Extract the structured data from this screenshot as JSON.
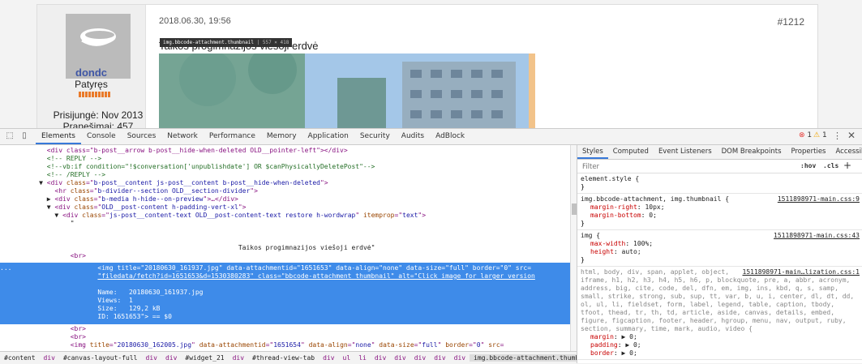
{
  "page": {
    "user": {
      "name": "dondc",
      "rank": "Patyręs",
      "joined": "Prisijungė: Nov 2013",
      "posts": "Pranešimai: 457"
    },
    "post": {
      "date": "2018.06.30, 19:56",
      "number": "#1212",
      "title": "Taikos progimnazijos viešoji erdvė",
      "tooltip_selector": "img.bbcode-attachment.thumbnail",
      "tooltip_size": "557 × 418"
    }
  },
  "devtools": {
    "tabs": [
      "Elements",
      "Console",
      "Sources",
      "Network",
      "Performance",
      "Memory",
      "Application",
      "Security",
      "Audits",
      "AdBlock"
    ],
    "active_tab": "Elements",
    "errors": "1",
    "warnings": "1",
    "dom": [
      {
        "indent": "            ",
        "parts": [
          [
            "t",
            "<div class=\"b-post__arrow b-post__hide-when-deleted OLD__pointer-left\"></div>"
          ]
        ]
      },
      {
        "indent": "            ",
        "parts": [
          [
            "c",
            "<!-- REPLY -->"
          ]
        ]
      },
      {
        "indent": "            ",
        "parts": [
          [
            "c",
            "<!--vb:if condition=\"!$conversation['unpublishdate'] OR $canPhysicallyDeletePost\"-->"
          ]
        ]
      },
      {
        "indent": "            ",
        "parts": [
          [
            "c",
            "<!-- /REPLY -->"
          ]
        ]
      },
      {
        "indent": "          ▼ ",
        "parts": [
          [
            "t",
            "<div "
          ],
          [
            "a",
            "class"
          ],
          [
            "t",
            "=\""
          ],
          [
            "v",
            "b-post__content js-post__content b-post__hide-when-deleted"
          ],
          [
            "t",
            "\">"
          ]
        ]
      },
      {
        "indent": "              ",
        "parts": [
          [
            "t",
            "<hr "
          ],
          [
            "a",
            "class"
          ],
          [
            "t",
            "=\""
          ],
          [
            "v",
            "b-divider--section OLD__section-divider"
          ],
          [
            "t",
            "\">"
          ]
        ]
      },
      {
        "indent": "            ▶ ",
        "parts": [
          [
            "t",
            "<div "
          ],
          [
            "a",
            "class"
          ],
          [
            "t",
            "=\""
          ],
          [
            "v",
            "b-media h-hide--on-preview"
          ],
          [
            "t",
            "\">…</div>"
          ]
        ]
      },
      {
        "indent": "            ▼ ",
        "parts": [
          [
            "t",
            "<div "
          ],
          [
            "a",
            "class"
          ],
          [
            "t",
            "=\""
          ],
          [
            "v",
            "OLD__post-content h-padding-vert-xl"
          ],
          [
            "t",
            "\">"
          ]
        ]
      },
      {
        "indent": "              ▼ ",
        "parts": [
          [
            "t",
            "<div "
          ],
          [
            "a",
            "class"
          ],
          [
            "t",
            "=\""
          ],
          [
            "v",
            "js-post__content-text OLD__post-content-text restore h-wordwrap"
          ],
          [
            "t",
            "\" "
          ],
          [
            "a",
            "itemprop"
          ],
          [
            "t",
            "=\""
          ],
          [
            "v",
            "text"
          ],
          [
            "t",
            "\">"
          ]
        ]
      },
      {
        "indent": "                  ",
        "parts": [
          [
            "x",
            "\""
          ]
        ]
      },
      {
        "indent": "",
        "parts": [
          [
            "x",
            " "
          ]
        ]
      },
      {
        "indent": "",
        "parts": [
          [
            "x",
            " "
          ]
        ]
      },
      {
        "indent": "                                                             ",
        "parts": [
          [
            "x",
            "Taikos progimnazijos viešoji erdvė\""
          ]
        ]
      },
      {
        "indent": "                  ",
        "parts": [
          [
            "t",
            "<br>"
          ]
        ]
      }
    ],
    "selected": [
      "<img title=\"20180630_161937.jpg\" data-attachmentid=\"1651653\" data-align=\"none\" data-size=\"full\" border=\"0\" src=",
      "\"filedata/fetch?id=1651653&d=1530380283\" class=\"bbcode-attachment thumbnail\" alt=\"Click image for larger version",
      "",
      "Name:   20180630_161937.jpg",
      "Views:  1",
      "Size:   129,2 kB",
      "ID: 1651653\"> == $0"
    ],
    "dom_after": [
      {
        "indent": "                  ",
        "parts": [
          [
            "t",
            "<br>"
          ]
        ]
      },
      {
        "indent": "                  ",
        "parts": [
          [
            "t",
            "<br>"
          ]
        ]
      },
      {
        "indent": "                  ",
        "parts": [
          [
            "t",
            "<img "
          ],
          [
            "a",
            "title"
          ],
          [
            "t",
            "=\""
          ],
          [
            "v",
            "20180630_162005.jpg"
          ],
          [
            "t",
            "\" "
          ],
          [
            "a",
            "data-attachmentid"
          ],
          [
            "t",
            "=\""
          ],
          [
            "v",
            "1651654"
          ],
          [
            "t",
            "\" "
          ],
          [
            "a",
            "data-align"
          ],
          [
            "t",
            "=\""
          ],
          [
            "v",
            "none"
          ],
          [
            "t",
            "\" "
          ],
          [
            "a",
            "data-size"
          ],
          [
            "t",
            "=\""
          ],
          [
            "v",
            "full"
          ],
          [
            "t",
            "\" "
          ],
          [
            "a",
            "border"
          ],
          [
            "t",
            "=\""
          ],
          [
            "v",
            "0"
          ],
          [
            "t",
            "\" "
          ],
          [
            "a",
            "src"
          ],
          [
            "t",
            "="
          ]
        ]
      }
    ],
    "breadcrumb": [
      "#content",
      "div",
      "#canvas-layout-full",
      "div",
      "div",
      "#widget_21",
      "div",
      "#thread-view-tab",
      "div",
      "ul",
      "li",
      "div",
      "div",
      "div",
      "div",
      "div",
      "img.bbcode-attachment.thumbnail"
    ],
    "styles_tabs": [
      "Styles",
      "Computed",
      "Event Listeners",
      "DOM Breakpoints",
      "Properties",
      "Accessibility"
    ],
    "filter_placeholder": "Filter",
    "hov": ":hov",
    "cls": ".cls",
    "rules": [
      {
        "selector": "element.style {",
        "source": "",
        "props": []
      },
      {
        "selector": "img.bbcode-attachment, img.thumbnail {",
        "source": "1511898971-main.css:9",
        "props": [
          [
            "margin-right",
            "10px;"
          ],
          [
            "margin-bottom",
            "0;"
          ]
        ]
      },
      {
        "selector": "img {",
        "source": "1511898971-main.css:43",
        "props": [
          [
            "max-width",
            "100%;"
          ],
          [
            "height",
            "auto;"
          ]
        ]
      }
    ],
    "long_rule": {
      "selector": "html, body, div, span, applet, object,",
      "source": "1511898971-main…lization.css:1",
      "text": "iframe, h1, h2, h3, h4, h5, h6, p, blockquote, pre, a, abbr, acronym, address, big, cite, code, del, dfn, em, img, ins, kbd, q, s, samp, small, strike, strong, sub, sup, tt, var, b, u, i, center, dl, dt, dd, ol, ul, li, fieldset, form, label, legend, table, caption, tbody, tfoot, thead, tr, th, td, article, aside, canvas, details, embed, figure, figcaption, footer, header, hgroup, menu, nav, output, ruby, section, summary, time, mark, audio, video {",
      "props": [
        [
          "margin",
          "▶ 0;"
        ],
        [
          "padding",
          "▶ 0;"
        ],
        [
          "border",
          "▶ 0;"
        ]
      ]
    }
  }
}
